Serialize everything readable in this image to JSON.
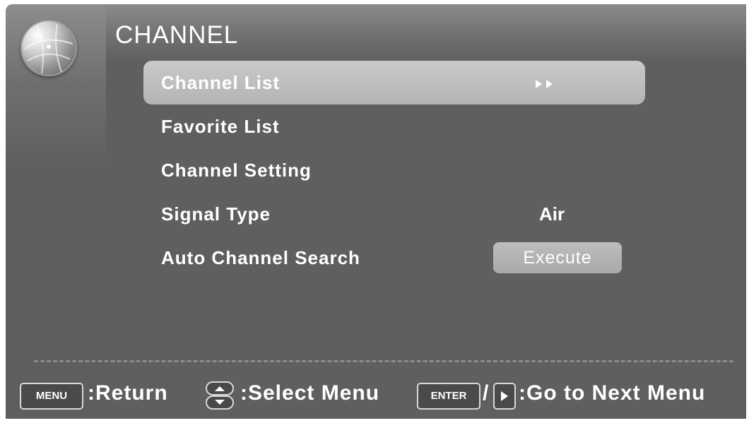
{
  "header": {
    "title": "CHANNEL",
    "logo_icon": "globe-icon"
  },
  "menu": {
    "items": [
      {
        "label": "Channel List",
        "selected": true,
        "value_icon": "double-right-arrow-icon"
      },
      {
        "label": "Favorite List"
      },
      {
        "label": "Channel Setting"
      },
      {
        "label": "Signal Type",
        "value": "Air"
      },
      {
        "label": "Auto Channel Search",
        "button": "Execute"
      }
    ]
  },
  "footer": {
    "menu_key": "MENU",
    "return_text": ":Return",
    "select_icon": "up-down-arrow-icon",
    "select_text": ":Select Menu",
    "enter_key": "ENTER",
    "slash": "/",
    "right_icon": "right-arrow-key-icon",
    "next_text": ":Go to Next Menu"
  },
  "colors": {
    "background": "#5f5f5f",
    "highlight": "#c0c0c0",
    "text": "#ffffff"
  }
}
